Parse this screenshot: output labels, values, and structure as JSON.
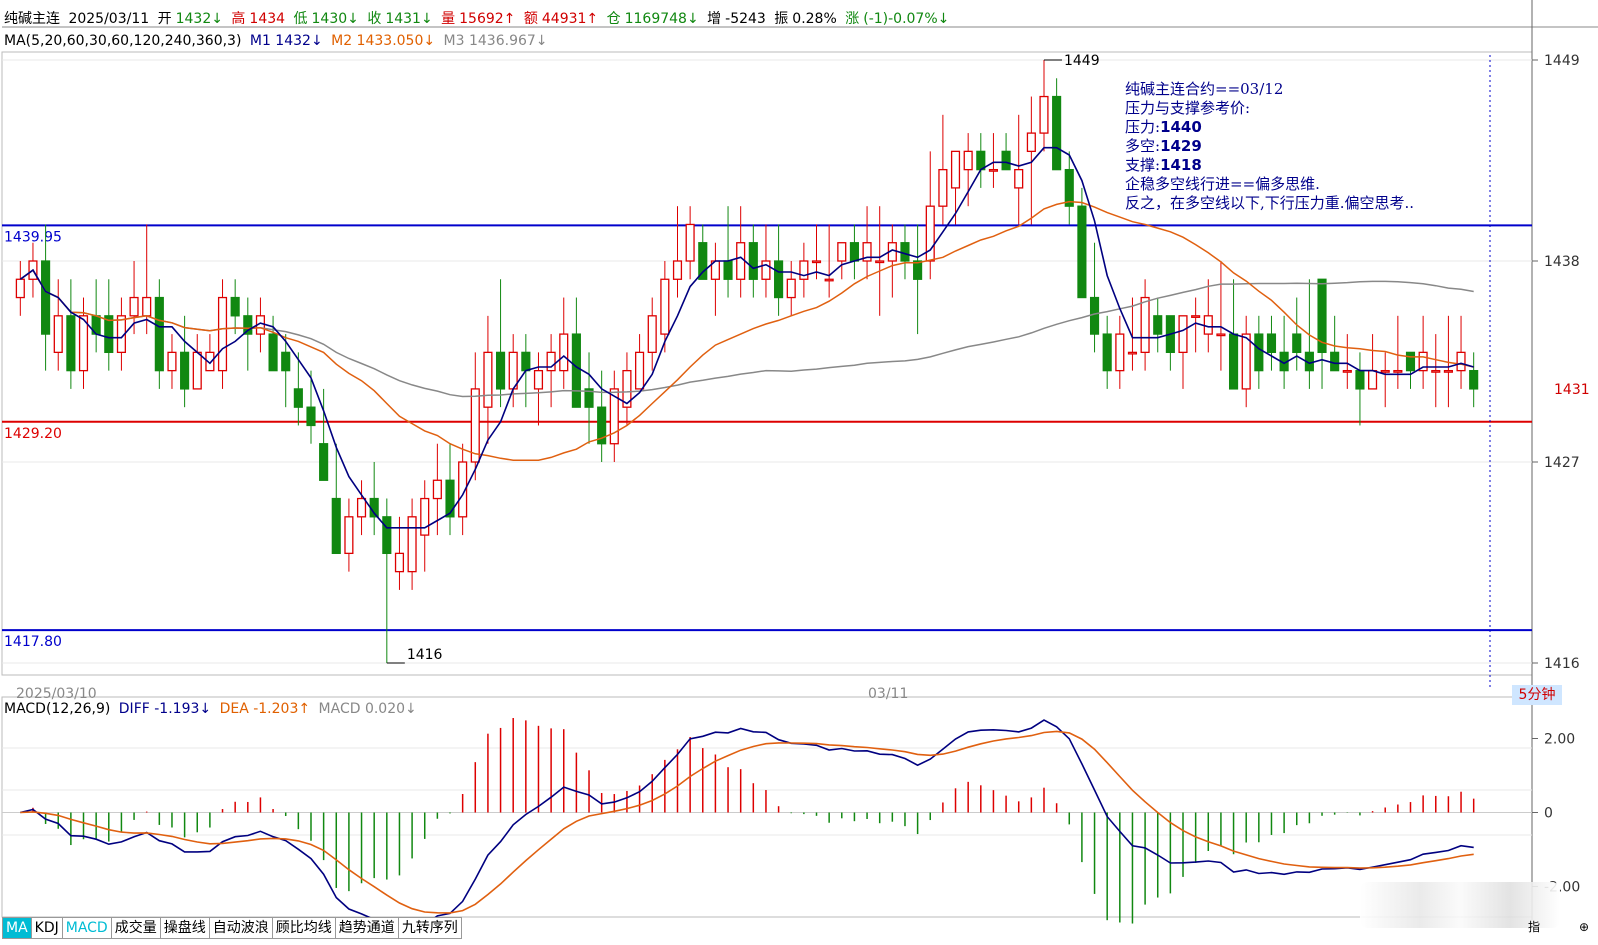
{
  "header": {
    "symbol": "纯碱主连",
    "date": "2025/03/11",
    "open_label": "开",
    "open": "1432↓",
    "high_label": "高",
    "high": "1434",
    "low_label": "低",
    "low": "1430↓",
    "close_label": "收",
    "close": "1431↓",
    "volume_label": "量",
    "volume": "15692↑",
    "amount_label": "额",
    "amount": "44931↑",
    "oi_label": "仓",
    "oi": "1169748↓",
    "oi_change_label": "增",
    "oi_change": "-5243",
    "amplitude_label": "振",
    "amplitude": "0.28%",
    "change_label": "涨",
    "change": "(-1)-0.07%↓"
  },
  "ma_row": {
    "params": "MA(5,20,60,30,60,120,240,360,3)",
    "m1": "M1 1432↓",
    "m2": "M2 1433.050↓",
    "m3": "M3 1436.967↓"
  },
  "macd_row": {
    "params": "MACD(12,26,9)",
    "diff": "DIFF -1.193↓",
    "dea": "DEA -1.203↑",
    "macd": "MACD 0.020↓"
  },
  "annotation": {
    "line1": "纯碱主连合约==03/12",
    "line2": "压力与支撑参考价:",
    "line3_label": "压力:",
    "line3_value": "1440",
    "line4_label": "多空:",
    "line4_value": "1429",
    "line5_label": "支撑:",
    "line5_value": "1418",
    "line6": "企稳多空线行进==偏多思维.",
    "line7": "反之，在多空线以下,下行压力重.偏空思考.."
  },
  "hlines": [
    {
      "value": 1439.95,
      "label": "1439.95",
      "color": "#0000cc"
    },
    {
      "value": 1429.2,
      "label": "1429.20",
      "color": "#dd0000"
    },
    {
      "value": 1417.8,
      "label": "1417.80",
      "color": "#0000cc"
    }
  ],
  "price_axis": {
    "ticks": [
      "1449",
      "1438",
      "1427",
      "1416"
    ],
    "current": "1431"
  },
  "macd_axis": {
    "ticks": [
      "2.00",
      "0",
      "-2.00"
    ]
  },
  "extremes": {
    "high": "1449",
    "low": "1416"
  },
  "dates": {
    "left": "2025/03/10",
    "mid": "03/11"
  },
  "period": "5分钟",
  "tabs": [
    "MA",
    "KDJ",
    "MACD",
    "成交量",
    "操盘线",
    "自动波浪",
    "顾比均线",
    "趋势通道",
    "九转序列"
  ],
  "colors": {
    "up": "#dd0000",
    "down": "#118811",
    "m1": "#000080",
    "m2": "#e06010",
    "m3": "#888888",
    "diff": "#000080",
    "dea": "#e06010"
  },
  "chart_data": {
    "type": "candlestick",
    "price_ylim": [
      1416,
      1449
    ],
    "candles": [
      [
        1436,
        1438,
        1435,
        1437
      ],
      [
        1437,
        1439,
        1436,
        1438
      ],
      [
        1438,
        1440,
        1432,
        1434
      ],
      [
        1433,
        1437,
        1432,
        1435
      ],
      [
        1435,
        1437,
        1431,
        1432
      ],
      [
        1432,
        1436,
        1431,
        1435
      ],
      [
        1435,
        1437,
        1433,
        1434
      ],
      [
        1435,
        1437,
        1432,
        1433
      ],
      [
        1433,
        1436,
        1432,
        1435
      ],
      [
        1435,
        1438,
        1434,
        1436
      ],
      [
        1435,
        1440,
        1434,
        1436
      ],
      [
        1436,
        1437,
        1431,
        1432
      ],
      [
        1432,
        1434,
        1431,
        1433
      ],
      [
        1433,
        1435,
        1430,
        1431
      ],
      [
        1431,
        1434,
        1431,
        1433
      ],
      [
        1432,
        1434,
        1432,
        1433
      ],
      [
        1432,
        1437,
        1431,
        1436
      ],
      [
        1436,
        1437,
        1434,
        1435
      ],
      [
        1435,
        1436,
        1432,
        1434
      ],
      [
        1434,
        1436,
        1433,
        1435
      ],
      [
        1434,
        1435,
        1432,
        1432
      ],
      [
        1433,
        1434,
        1430,
        1432
      ],
      [
        1431,
        1433,
        1429,
        1430
      ],
      [
        1430,
        1432,
        1428,
        1429
      ],
      [
        1428,
        1431,
        1426,
        1426
      ],
      [
        1425,
        1428,
        1422,
        1422
      ],
      [
        1422,
        1425,
        1421,
        1424
      ],
      [
        1424,
        1426,
        1423,
        1425
      ],
      [
        1425,
        1427,
        1423,
        1424
      ],
      [
        1424,
        1425,
        1416,
        1422
      ],
      [
        1421,
        1424,
        1420,
        1422
      ],
      [
        1421,
        1425,
        1420,
        1424
      ],
      [
        1423,
        1426,
        1421,
        1425
      ],
      [
        1425,
        1428,
        1423,
        1426
      ],
      [
        1426,
        1428,
        1423,
        1424
      ],
      [
        1424,
        1428,
        1423,
        1427
      ],
      [
        1427,
        1433,
        1426,
        1431
      ],
      [
        1430,
        1435,
        1428,
        1433
      ],
      [
        1433,
        1437,
        1430,
        1431
      ],
      [
        1431,
        1434,
        1430,
        1433
      ],
      [
        1433,
        1434,
        1430,
        1432
      ],
      [
        1431,
        1433,
        1429,
        1432
      ],
      [
        1432,
        1434,
        1430,
        1433
      ],
      [
        1432,
        1436,
        1431,
        1434
      ],
      [
        1434,
        1436,
        1430,
        1430
      ],
      [
        1431,
        1433,
        1428,
        1430
      ],
      [
        1430,
        1432,
        1427,
        1428
      ],
      [
        1428,
        1432,
        1427,
        1431
      ],
      [
        1430,
        1433,
        1429,
        1432
      ],
      [
        1431,
        1434,
        1431,
        1433
      ],
      [
        1433,
        1436,
        1432,
        1435
      ],
      [
        1434,
        1438,
        1433,
        1437
      ],
      [
        1437,
        1441,
        1436,
        1438
      ],
      [
        1438,
        1441,
        1437,
        1440
      ],
      [
        1439,
        1440,
        1437,
        1437
      ],
      [
        1437,
        1439,
        1435,
        1438
      ],
      [
        1438,
        1441,
        1436,
        1437
      ],
      [
        1437,
        1441,
        1436,
        1439
      ],
      [
        1439,
        1440,
        1436,
        1437
      ],
      [
        1437,
        1440,
        1436,
        1438
      ],
      [
        1438,
        1440,
        1435,
        1436
      ],
      [
        1436,
        1438,
        1435,
        1437
      ],
      [
        1437,
        1439,
        1436,
        1438
      ],
      [
        1438,
        1440,
        1437,
        1438
      ],
      [
        1437,
        1440,
        1436,
        1437
      ],
      [
        1438,
        1439,
        1437,
        1439
      ],
      [
        1439,
        1440,
        1437,
        1438
      ],
      [
        1438,
        1441,
        1437,
        1439
      ],
      [
        1438,
        1441,
        1435,
        1438
      ],
      [
        1438,
        1440,
        1436,
        1439
      ],
      [
        1439,
        1440,
        1437,
        1438
      ],
      [
        1438,
        1440,
        1434,
        1437
      ],
      [
        1438,
        1444,
        1437,
        1441
      ],
      [
        1441,
        1446,
        1440,
        1443
      ],
      [
        1442,
        1444,
        1440,
        1444
      ],
      [
        1443,
        1445,
        1441,
        1444
      ],
      [
        1444,
        1445,
        1442,
        1443
      ],
      [
        1443,
        1445,
        1442,
        1443
      ],
      [
        1444,
        1445,
        1443,
        1443
      ],
      [
        1442,
        1446,
        1440,
        1443
      ],
      [
        1444,
        1447,
        1440,
        1445
      ],
      [
        1445,
        1449,
        1444,
        1447
      ],
      [
        1447,
        1448,
        1443,
        1443
      ],
      [
        1443,
        1444,
        1440,
        1441
      ],
      [
        1441,
        1442,
        1437,
        1436
      ],
      [
        1436,
        1439,
        1433,
        1434
      ],
      [
        1434,
        1435,
        1431,
        1432
      ],
      [
        1432,
        1435,
        1431,
        1434
      ],
      [
        1433,
        1436,
        1432,
        1433
      ],
      [
        1433,
        1437,
        1432,
        1436
      ],
      [
        1435,
        1436,
        1433,
        1434
      ],
      [
        1435,
        1435,
        1432,
        1433
      ],
      [
        1433,
        1435,
        1431,
        1435
      ],
      [
        1435,
        1436,
        1433,
        1435
      ],
      [
        1434,
        1437,
        1433,
        1435
      ],
      [
        1434,
        1438,
        1432,
        1434
      ],
      [
        1434,
        1437,
        1431,
        1431
      ],
      [
        1431,
        1435,
        1430,
        1434
      ],
      [
        1434,
        1435,
        1431,
        1432
      ],
      [
        1434,
        1435,
        1432,
        1433
      ],
      [
        1433,
        1435,
        1431,
        1432
      ],
      [
        1434,
        1436,
        1432,
        1433
      ],
      [
        1433,
        1437,
        1431,
        1432
      ],
      [
        1437,
        1437,
        1431,
        1433
      ],
      [
        1433,
        1435,
        1432,
        1432
      ],
      [
        1432,
        1434,
        1431,
        1432
      ],
      [
        1432,
        1433,
        1429,
        1431
      ],
      [
        1431,
        1434,
        1431,
        1432
      ],
      [
        1432,
        1433,
        1430,
        1432
      ],
      [
        1432,
        1435,
        1431,
        1432
      ],
      [
        1433,
        1433,
        1431,
        1432
      ],
      [
        1432,
        1435,
        1431,
        1433
      ],
      [
        1432,
        1434,
        1430,
        1432
      ],
      [
        1432,
        1435,
        1430,
        1432
      ],
      [
        1432,
        1435,
        1431,
        1433
      ],
      [
        1432,
        1433,
        1430,
        1431
      ]
    ],
    "macd_ylim": [
      -2.5,
      2.5
    ]
  }
}
